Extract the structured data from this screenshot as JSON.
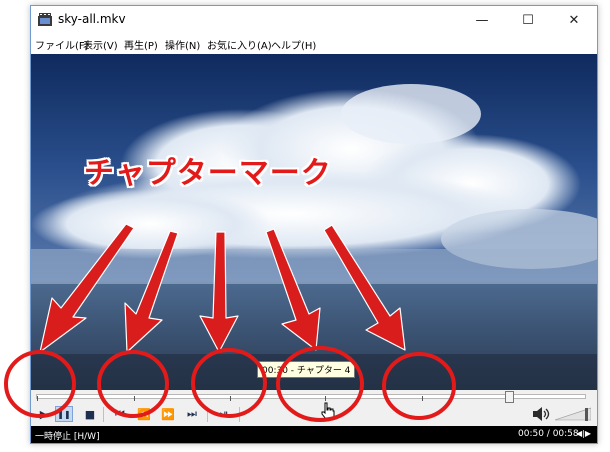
{
  "window": {
    "title": "sky-all.mkv",
    "min_glyph": "—",
    "max_glyph": "☐",
    "close_glyph": "✕"
  },
  "menu": [
    {
      "label": "ファイル(F)"
    },
    {
      "label": "表示(V)"
    },
    {
      "label": "再生(P)"
    },
    {
      "label": "操作(N)"
    },
    {
      "label": "お気に入り(A)"
    },
    {
      "label": "ヘルプ(H)"
    }
  ],
  "annotation": {
    "headline": "チャプターマーク",
    "color": "#e21a1a"
  },
  "tooltip": {
    "text": "00:30 - チャプター 4"
  },
  "seek": {
    "position_fraction": 0.862,
    "chapter_fractions": [
      0.0,
      0.177,
      0.353,
      0.525,
      0.702
    ]
  },
  "controls": {
    "play": "▶",
    "pause": "❚❚",
    "stop": "■",
    "prev_chapter": "⏮",
    "rewind": "⏪",
    "fast_forward": "⏩",
    "next_chapter": "⏭",
    "frame_step": "⏯"
  },
  "volume": {
    "level_fraction": 0.9
  },
  "status": {
    "left": "一時停止 [H/W]",
    "time": "00:50 / 00:58",
    "right_glyph": "◀|▶"
  }
}
